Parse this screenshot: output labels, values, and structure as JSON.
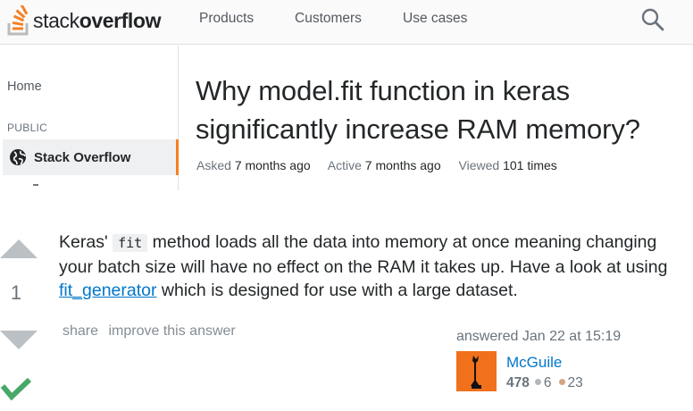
{
  "topbar": {
    "logo_light": "stack",
    "logo_bold": "overflow",
    "nav": [
      "Products",
      "Customers",
      "Use cases"
    ],
    "search_icon": "search-icon",
    "brand_color": "#f48024"
  },
  "sidebar": {
    "home": "Home",
    "section": "PUBLIC",
    "active_item": "Stack Overflow",
    "active_icon": "globe-icon"
  },
  "question": {
    "title": "Why model.fit function in keras significantly increase RAM memory?",
    "asked_label": "Asked",
    "asked_value": "7 months ago",
    "active_label": "Active",
    "active_value": "7 months ago",
    "viewed_label": "Viewed",
    "viewed_value": "101 times"
  },
  "answer": {
    "votes": "1",
    "accepted": true,
    "accept_icon": "checkmark-icon",
    "text_1": "Keras'",
    "code_1": "fit",
    "text_2": "method loads all the data into memory at once meaning changing your batch size will have no effect on the RAM it takes up. Have a look at using",
    "link": "fit_generator",
    "text_3": "which is designed for use with a large dataset.",
    "share": "share",
    "improve": "improve this answer",
    "answered": "answered Jan 22 at 15:19",
    "user": {
      "name": "McGuile",
      "reputation": "478",
      "silver": "6",
      "bronze": "23"
    }
  }
}
